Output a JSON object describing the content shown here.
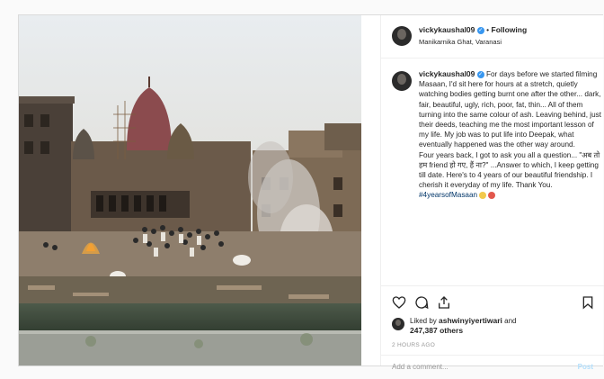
{
  "post": {
    "username": "vickykaushal09",
    "follow_sep": "•",
    "follow_label": "Following",
    "location": "Manikarnika Ghat, Varanasi",
    "caption_username": "vickykaushal09",
    "caption_body": "For days before we started filming Masaan, I'd sit here for hours at a stretch, quietly watching bodies getting burnt one after the other... dark, fair, beautiful, ugly, rich, poor, fat, thin... All of them turning into the same colour of ash. Leaving behind, just their deeds, teaching me the most important lesson of my life. My job was to put life into Deepak, what eventually happened was the other way around.",
    "caption_body2": "Four years back, I got to ask you all a question... \"अब तो हम friend हो गए, हैं ना?\" ...Answer to which, I keep getting till date. Here's to 4 years of our beautiful friendship. I cherish it everyday of my life. Thank You.",
    "hashtag": "#4yearsofMasaan",
    "liked_by_prefix": "Liked by ",
    "liked_by_user": "ashwinyiyertiwari",
    "liked_by_and": " and",
    "likes_count": "247,387 others",
    "time_ago": "2 HOURS AGO",
    "comment_placeholder": "Add a comment...",
    "post_label": "Post"
  },
  "colors": {
    "accent": "#3897f0",
    "text": "#262626",
    "muted": "#999999"
  },
  "icons": [
    "heart-icon",
    "comment-icon",
    "share-icon",
    "bookmark-icon",
    "verified-badge-icon"
  ]
}
